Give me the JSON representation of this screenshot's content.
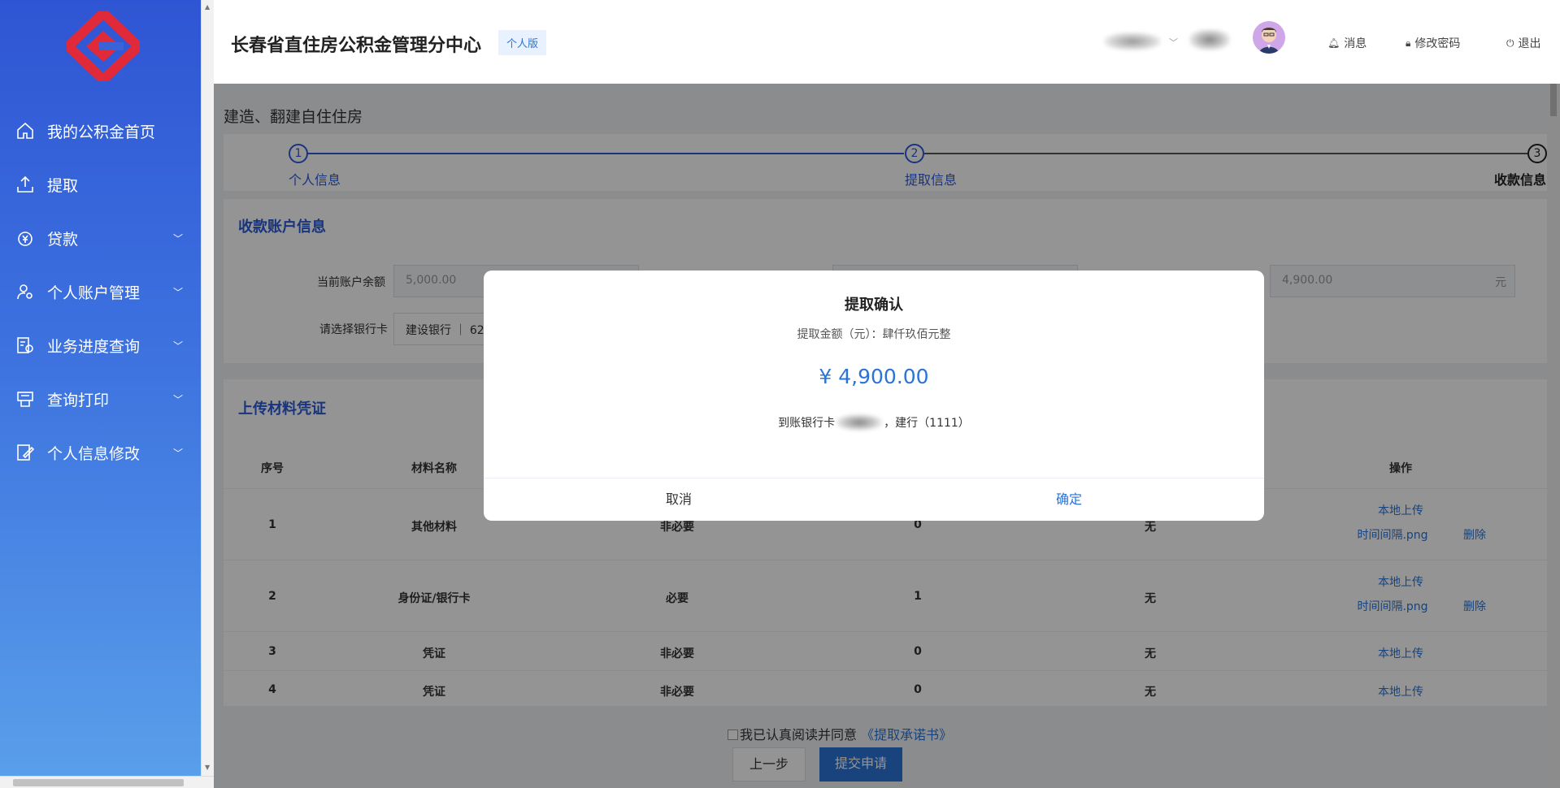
{
  "sidebar": {
    "items": [
      {
        "label": "我的公积金首页",
        "icon": "home-icon",
        "has_chevron": false
      },
      {
        "label": "提取",
        "icon": "upload-icon",
        "has_chevron": false
      },
      {
        "label": "贷款",
        "icon": "money-bag-icon",
        "has_chevron": true
      },
      {
        "label": "个人账户管理",
        "icon": "user-settings-icon",
        "has_chevron": true
      },
      {
        "label": "业务进度查询",
        "icon": "progress-icon",
        "has_chevron": true
      },
      {
        "label": "查询打印",
        "icon": "printer-icon",
        "has_chevron": true
      },
      {
        "label": "个人信息修改",
        "icon": "edit-info-icon",
        "has_chevron": true
      }
    ]
  },
  "header": {
    "title": "长春省直住房公积金管理分中心",
    "badge": "个人版",
    "links": {
      "messages": "消息",
      "change_password": "修改密码",
      "logout": "退出"
    }
  },
  "page": {
    "title": "建造、翻建自住住房",
    "steps": [
      {
        "num": "1",
        "label": "个人信息",
        "state": "done"
      },
      {
        "num": "2",
        "label": "提取信息",
        "state": "active"
      },
      {
        "num": "3",
        "label": "收款信息",
        "state": "current"
      }
    ],
    "account_card": {
      "title": "收款账户信息",
      "balance_label": "当前账户余额",
      "balance_value": "5,000.00",
      "amount_value": "4,900.00",
      "amount_unit": "元",
      "bank_label": "请选择银行卡",
      "bank_value": "建设银行 ｜ 621"
    },
    "upload_card": {
      "title": "上传材料凭证",
      "headers": {
        "index": "序号",
        "name": "材料名称",
        "action": "操作"
      },
      "rows": [
        {
          "index": "1",
          "name": "其他材料",
          "required": "非必要",
          "count": "0",
          "note": "无",
          "upload": "本地上传",
          "file": "时间间隔.png",
          "delete": "删除"
        },
        {
          "index": "2",
          "name": "身份证/银行卡",
          "required": "必要",
          "count": "1",
          "note": "无",
          "upload": "本地上传",
          "file": "时间间隔.png",
          "delete": "删除"
        },
        {
          "index": "3",
          "name": "凭证",
          "required": "非必要",
          "count": "0",
          "note": "无",
          "upload": "本地上传",
          "file": "",
          "delete": ""
        },
        {
          "index": "4",
          "name": "凭证",
          "required": "非必要",
          "count": "0",
          "note": "无",
          "upload": "本地上传",
          "file": "",
          "delete": ""
        }
      ]
    },
    "agreement": {
      "text": "我已认真阅读并同意",
      "link": "《提取承诺书》"
    },
    "buttons": {
      "prev": "上一步",
      "submit": "提交申请"
    }
  },
  "modal": {
    "title": "提取确认",
    "subtitle": "提取金额（元）：肆仟玖佰元整",
    "amount": "¥ 4,900.00",
    "bank_prefix": "到账银行卡",
    "bank_suffix": "，建行（1111）",
    "cancel": "取消",
    "confirm": "确定"
  },
  "colors": {
    "primary": "#2a74d8",
    "step_active": "#2a5bd7",
    "sidebar_top": "#2f55d4",
    "sidebar_bottom": "#5aa0ea",
    "logo": "#e02a3a"
  }
}
